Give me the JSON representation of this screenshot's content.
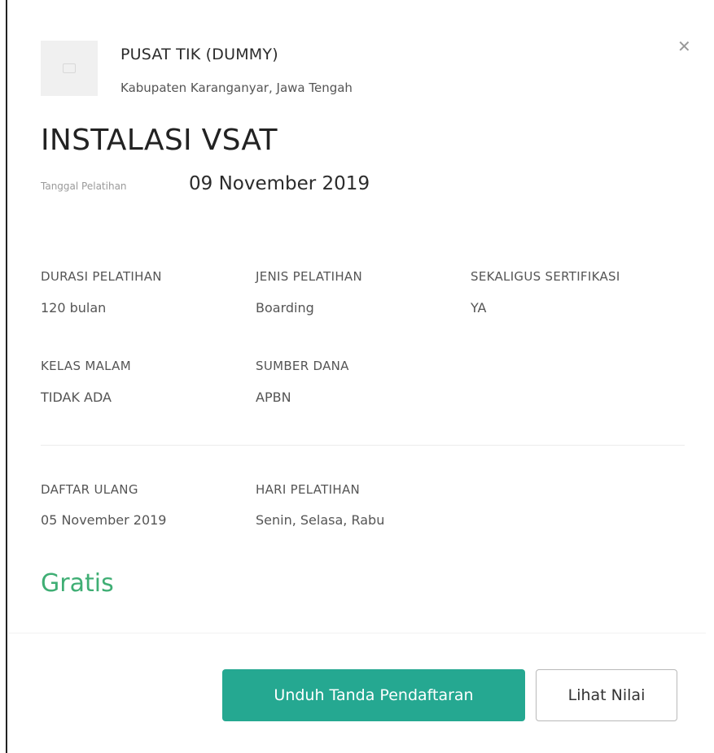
{
  "org": {
    "name": "PUSAT TIK (DUMMY)",
    "location": "Kabupaten Karanganyar, Jawa Tengah"
  },
  "icons": {
    "close": "close-icon",
    "logo": "image-placeholder-icon"
  },
  "course": {
    "title": "INSTALASI VSAT",
    "date_label": "Tanggal Pelatihan",
    "date_value": "09 November 2019"
  },
  "details": {
    "durasi": {
      "label": "DURASI PELATIHAN",
      "value": "120 bulan"
    },
    "jenis": {
      "label": "JENIS PELATIHAN",
      "value": "Boarding"
    },
    "sertifikasi": {
      "label": "SEKALIGUS SERTIFIKASI",
      "value": "YA"
    },
    "kelas_malam": {
      "label": "KELAS MALAM",
      "value": "TIDAK ADA"
    },
    "sumber_dana": {
      "label": "SUMBER DANA",
      "value": "APBN"
    },
    "daftar_ulang": {
      "label": "DAFTAR ULANG",
      "value": "05 November 2019"
    },
    "hari": {
      "label": "HARI PELATIHAN",
      "value": "Senin, Selasa, Rabu"
    }
  },
  "price": "Gratis",
  "buttons": {
    "download": "Unduh Tanda Pendaftaran",
    "view_score": "Lihat Nilai"
  },
  "colors": {
    "accent": "#25a891",
    "price": "#3fae74"
  }
}
